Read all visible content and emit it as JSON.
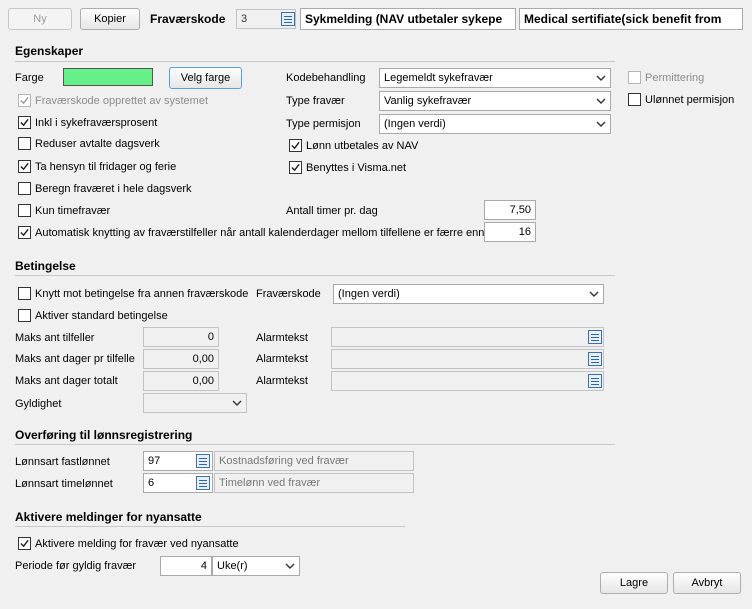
{
  "toolbar": {
    "ny_label": "Ny",
    "kopier_label": "Kopier",
    "fravaerskode_label": "Fraværskode",
    "code_value": "3",
    "name_no": "Sykmelding (NAV utbetaler sykepe",
    "name_en": "Medical sertifiate(sick benefit from"
  },
  "egenskaper": {
    "title": "Egenskaper",
    "farge_label": "Farge",
    "farge_color": "#66f08a",
    "velg_farge_label": "Velg farge",
    "opprettet_label": "Fraværskode opprettet av systemet",
    "inkl_label": "Inkl i sykefraværsprosent",
    "reduser_label": "Reduser avtalte dagsverk",
    "ta_hensyn_label": "Ta hensyn til fridager og ferie",
    "beregn_label": "Beregn fraværet i hele dagsverk",
    "kun_label": "Kun timefravær",
    "automatisk_label": "Automatisk knytting av fraværstilfeller når antall kalenderdager mellom tilfellene er færre enn",
    "kodebehandling_label": "Kodebehandling",
    "kodebehandling_value": "Legemeldt sykefravær",
    "type_fravaer_label": "Type fravær",
    "type_fravaer_value": "Vanlig sykefravær",
    "type_permisjon_label": "Type permisjon",
    "type_permisjon_value": "(Ingen verdi)",
    "lonn_label": "Lønn utbetales av NAV",
    "benyttes_label": "Benyttes i Visma.net",
    "antall_timer_label": "Antall timer pr. dag",
    "antall_timer_value": "7,50",
    "automatisk_value": "16",
    "permittering_label": "Permittering",
    "ulonnet_label": "Ulønnet permisjon"
  },
  "betingelse": {
    "title": "Betingelse",
    "knytt_label": "Knytt mot betingelse fra annen fraværskode",
    "fravaerskode_label": "Fraværskode",
    "fravaerskode_value": "(Ingen verdi)",
    "aktiver_label": "Aktiver standard betingelse",
    "maks_tilfeller_label": "Maks ant tilfeller",
    "maks_tilfeller_value": "0",
    "maks_dager_tilfelle_label": "Maks ant dager pr tilfelle",
    "maks_dager_tilfelle_value": "0,00",
    "maks_dager_totalt_label": "Maks ant dager totalt",
    "maks_dager_totalt_value": "0,00",
    "alarmtekst_label": "Alarmtekst",
    "gyldighet_label": "Gyldighet"
  },
  "overforing": {
    "title": "Overføring til lønnsregistrering",
    "fastlonnet_label": "Lønnsart fastlønnet",
    "fastlonnet_value": "97",
    "fastlonnet_desc": "Kostnadsføring ved fravær",
    "timelonnet_label": "Lønnsart timelønnet",
    "timelonnet_value": "6",
    "timelonnet_desc": "Timelønn ved fravær"
  },
  "aktivere": {
    "title": "Aktivere meldinger for nyansatte",
    "melding_label": "Aktivere melding for fravær ved nyansatte",
    "periode_label": "Periode før gyldig fravær",
    "periode_value": "4",
    "periode_unit": "Uke(r)"
  },
  "footer": {
    "lagre_label": "Lagre",
    "avbryt_label": "Avbryt"
  }
}
